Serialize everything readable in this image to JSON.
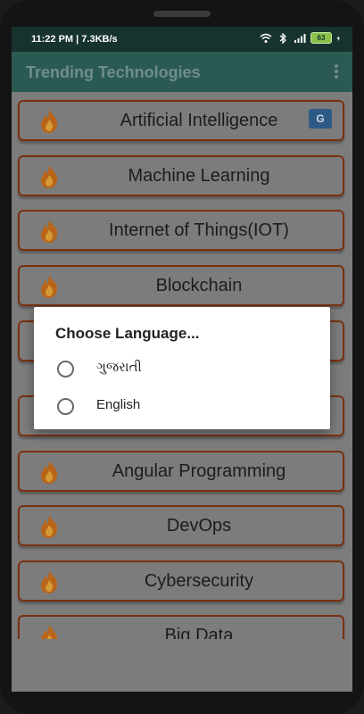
{
  "status_bar": {
    "time": "11:22 PM | 7.3KB/s",
    "battery": "63"
  },
  "app_bar": {
    "title": "Trending Technologies"
  },
  "list": {
    "items": [
      {
        "label": "Artificial Intelligence"
      },
      {
        "label": "Machine Learning"
      },
      {
        "label": "Internet of Things(IOT)"
      },
      {
        "label": "Blockchain"
      },
      {
        "label": ""
      },
      {
        "label": ""
      },
      {
        "label": "Angular Programming"
      },
      {
        "label": "DevOps"
      },
      {
        "label": "Cybersecurity"
      },
      {
        "label": "Big Data"
      }
    ]
  },
  "dialog": {
    "title": "Choose Language...",
    "options": [
      {
        "label": "ગુજરાતી"
      },
      {
        "label": "English"
      }
    ]
  },
  "colors": {
    "status_bar": "#17332e",
    "app_bar": "#2b5a53",
    "item_border": "#7a3010",
    "scrim": "#7c7c7c"
  }
}
